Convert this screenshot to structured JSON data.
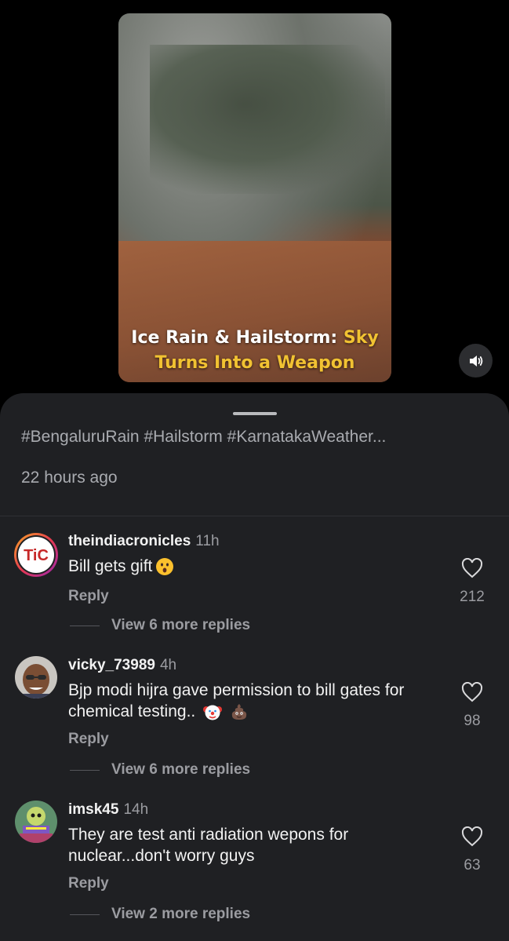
{
  "video": {
    "caption_white": "Ice Rain & Hailstorm:",
    "caption_yellow_1": "Sky",
    "caption_yellow_2": "Turns Into a Weapon",
    "mute_icon": "speaker-icon"
  },
  "post": {
    "hashtags": "#BengaluruRain #Hailstorm #KarnatakaWeather...",
    "time_ago": "22 hours ago"
  },
  "comments": [
    {
      "username": "theindiacronicles",
      "age": "11h",
      "text": "Bill gets gift",
      "emoji": [
        "astonished-face-icon"
      ],
      "likes": "212",
      "reply_label": "Reply",
      "view_more": "View 6 more replies",
      "avatar_text": "TiC"
    },
    {
      "username": "vicky_73989",
      "age": "4h",
      "text": "Bjp modi hijra gave permission to bill gates for chemical testing..",
      "emoji": [
        "clown-face-icon",
        "pile-of-poo-icon"
      ],
      "likes": "98",
      "reply_label": "Reply",
      "view_more": "View 6 more replies"
    },
    {
      "username": "imsk45",
      "age": "14h",
      "text": "They are test anti radiation wepons for nuclear...don't worry guys",
      "likes": "63",
      "reply_label": "Reply",
      "view_more": "View 2 more replies"
    }
  ],
  "colors": {
    "sheet_bg": "#1f2023",
    "caption_yellow": "#f1c232",
    "muted_text": "#9b9ca1"
  }
}
